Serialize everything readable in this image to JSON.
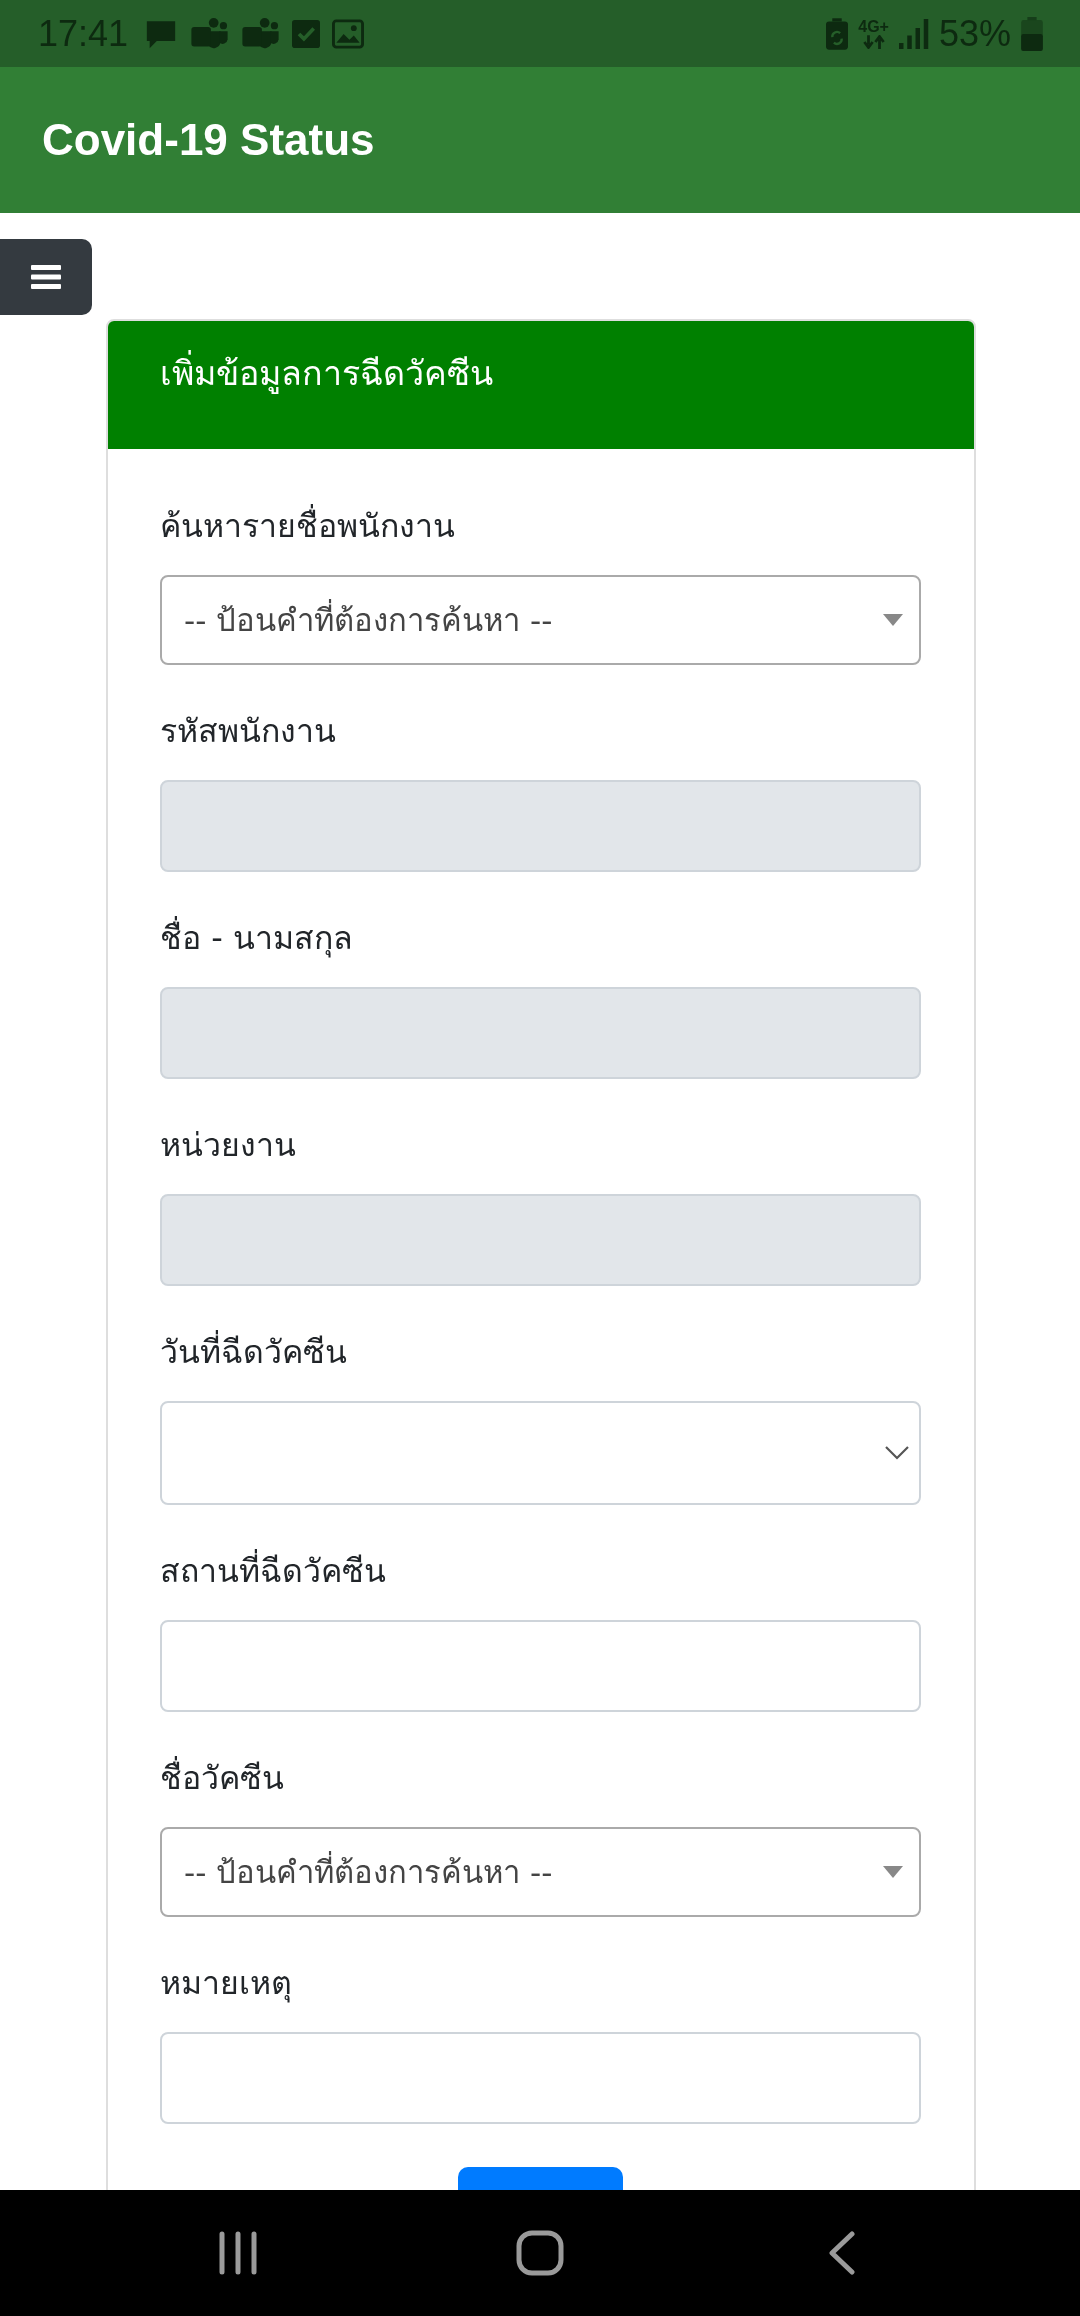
{
  "status_bar": {
    "time": "17:41",
    "network": "4G+",
    "battery": "53%"
  },
  "app_bar": {
    "title": "Covid-19 Status"
  },
  "card": {
    "title": "เพิ่มข้อมูลการฉีดวัคซีน",
    "fields": [
      {
        "label": "ค้นหารายชื่อพนักงาน",
        "kind": "search_select",
        "placeholder": "-- ป้อนคำที่ต้องการค้นหา --",
        "disabled": false
      },
      {
        "label": "รหัสพนักงาน",
        "kind": "text",
        "disabled": true
      },
      {
        "label": "ชื่อ - นามสกุล",
        "kind": "text",
        "disabled": true
      },
      {
        "label": "หน่วยงาน",
        "kind": "text",
        "disabled": true
      },
      {
        "label": "วันที่ฉีดวัคซีน",
        "kind": "date",
        "disabled": false
      },
      {
        "label": "สถานที่ฉีดวัคซีน",
        "kind": "text",
        "disabled": false
      },
      {
        "label": "ชื่อวัคซีน",
        "kind": "search_select",
        "placeholder": "-- ป้อนคำที่ต้องการค้นหา --",
        "disabled": false
      },
      {
        "label": "หมายเหตุ",
        "kind": "text",
        "disabled": false
      }
    ],
    "actions": [
      {
        "kind": "primary"
      }
    ]
  }
}
